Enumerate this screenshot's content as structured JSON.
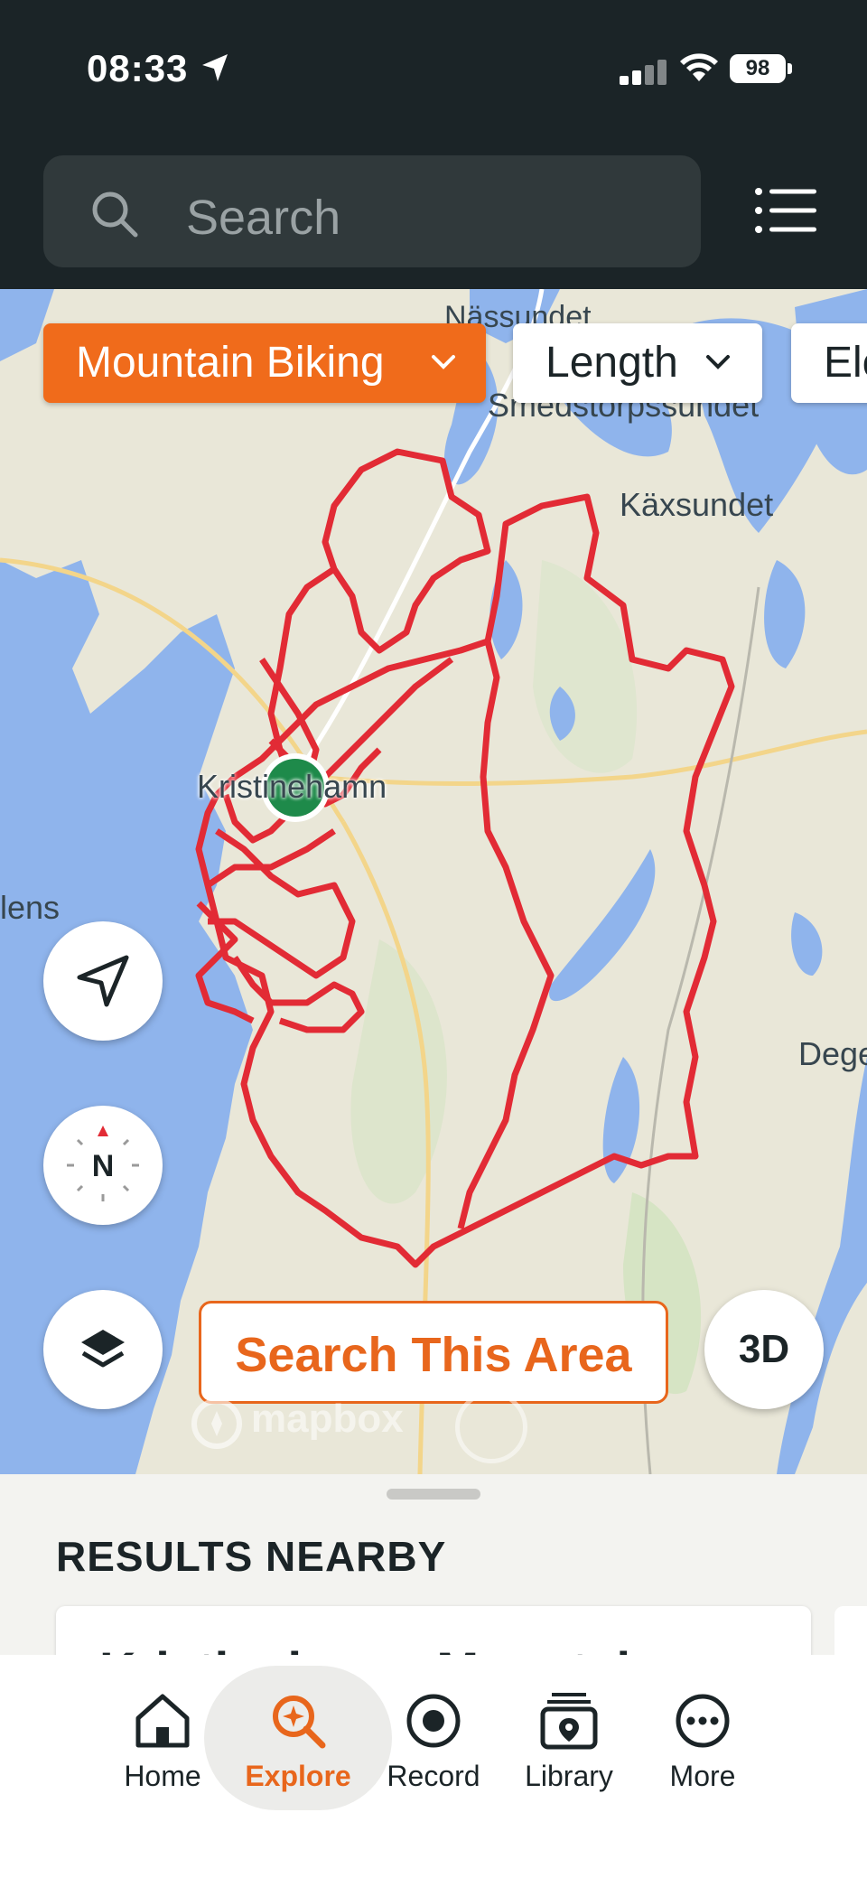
{
  "status_bar": {
    "time": "08:33",
    "battery": "98"
  },
  "search": {
    "placeholder": "Search"
  },
  "filters": {
    "activity": "Mountain Biking",
    "length": "Length",
    "elevation": "Ele"
  },
  "map": {
    "places": {
      "nassundet": "Nässundet",
      "smedstorp": "Smedstorpssundet",
      "kaxsundet": "Käxsundet",
      "kristinehamn": "Kristinehamn",
      "lens": "lens",
      "dege": "Dege"
    },
    "search_area": "Search This Area",
    "three_d": "3D",
    "compass": "N",
    "attribution": "mapbox"
  },
  "results": {
    "heading": "RESULTS NEARBY",
    "first_title": "Kristinehamn Mountain"
  },
  "tabbar": [
    {
      "label": "Home"
    },
    {
      "label": "Explore"
    },
    {
      "label": "Record"
    },
    {
      "label": "Library"
    },
    {
      "label": "More"
    }
  ],
  "colors": {
    "accent": "#e8661c",
    "route": "#e22b35",
    "water": "#8fb4ec",
    "land": "#e9e7d8",
    "dark": "#1b2427"
  }
}
